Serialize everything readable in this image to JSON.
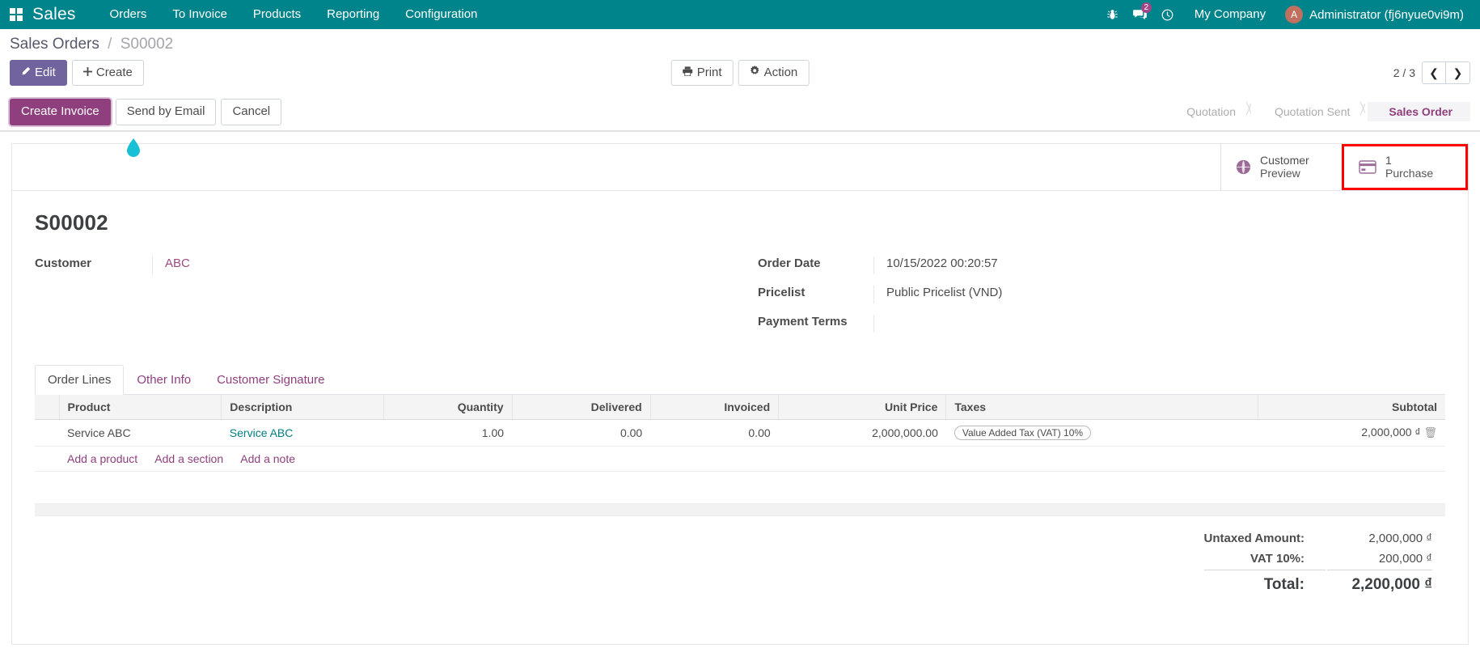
{
  "navbar": {
    "apps_icon": "apps-grid-icon",
    "brand": "Sales",
    "menu": [
      {
        "label": "Orders"
      },
      {
        "label": "To Invoice"
      },
      {
        "label": "Products"
      },
      {
        "label": "Reporting"
      },
      {
        "label": "Configuration"
      }
    ],
    "icons": [
      {
        "name": "bug-icon",
        "glyph": "☣"
      },
      {
        "name": "messages-icon",
        "glyph": "✉",
        "badge": "2"
      },
      {
        "name": "activities-clock-icon",
        "glyph": "⏱"
      }
    ],
    "company": "My Company",
    "user": {
      "initial": "A",
      "name": "Administrator (fj6nyue0vi9m)"
    }
  },
  "breadcrumb": {
    "root": "Sales Orders",
    "separator": "/",
    "current": "S00002"
  },
  "toolbar": {
    "edit_label": "Edit",
    "edit_icon": "pencil-icon",
    "create_label": "Create",
    "create_icon": "plus-icon",
    "print_label": "Print",
    "print_icon": "printer-icon",
    "action_label": "Action",
    "action_icon": "gear-icon"
  },
  "pager": {
    "value": "2 / 3",
    "prev_icon": "chevron-left-icon",
    "next_icon": "chevron-right-icon"
  },
  "statusbar_actions": [
    {
      "label": "Create Invoice",
      "style": "primary",
      "focused": true
    },
    {
      "label": "Send by Email",
      "style": "default",
      "focused": false
    },
    {
      "label": "Cancel",
      "style": "default",
      "focused": false
    }
  ],
  "statusbar_stages": [
    {
      "label": "Quotation",
      "active": false
    },
    {
      "label": "Quotation Sent",
      "active": false
    },
    {
      "label": "Sales Order",
      "active": true
    }
  ],
  "smart_buttons": [
    {
      "name": "customer-preview",
      "icon": "globe-icon",
      "line1": "Customer",
      "line2": "Preview",
      "highlighted": false
    },
    {
      "name": "purchase",
      "icon": "credit-card-icon",
      "line1": "1",
      "line2": "Purchase",
      "highlighted": true
    }
  ],
  "record": {
    "title": "S00002",
    "left_fields": [
      {
        "label": "Customer",
        "value": "ABC",
        "is_link": true
      }
    ],
    "right_fields": [
      {
        "label": "Order Date",
        "value": "10/15/2022 00:20:57",
        "is_link": false
      },
      {
        "label": "Pricelist",
        "value": "Public Pricelist (VND)",
        "is_link": false
      },
      {
        "label": "Payment Terms",
        "value": "",
        "is_link": false
      }
    ]
  },
  "tabs": [
    {
      "label": "Order Lines",
      "active": true
    },
    {
      "label": "Other Info",
      "active": false
    },
    {
      "label": "Customer Signature",
      "active": false
    }
  ],
  "order_lines": {
    "columns": [
      {
        "label": "Product",
        "align": "left"
      },
      {
        "label": "Description",
        "align": "left"
      },
      {
        "label": "Quantity",
        "align": "right"
      },
      {
        "label": "Delivered",
        "align": "right"
      },
      {
        "label": "Invoiced",
        "align": "right"
      },
      {
        "label": "Unit Price",
        "align": "right"
      },
      {
        "label": "Taxes",
        "align": "left"
      },
      {
        "label": "Subtotal",
        "align": "right"
      }
    ],
    "rows": [
      {
        "product": "Service ABC",
        "description": "Service ABC",
        "quantity": "1.00",
        "delivered": "0.00",
        "invoiced": "0.00",
        "unit_price": "2,000,000.00",
        "taxes": "Value Added Tax (VAT) 10%",
        "subtotal": "2,000,000 ₫",
        "delete_icon": "trash-icon"
      }
    ],
    "add_links": [
      {
        "label": "Add a product"
      },
      {
        "label": "Add a section"
      },
      {
        "label": "Add a note"
      }
    ]
  },
  "totals": {
    "untaxed_label": "Untaxed Amount:",
    "untaxed_value": "2,000,000 ₫",
    "tax_label": "VAT 10%:",
    "tax_value": "200,000 ₫",
    "total_label": "Total:",
    "total_value": "2,200,000 ₫"
  },
  "colors": {
    "navbar": "#00848c",
    "primary": "#71639e",
    "accent_purple": "#8f3f7e",
    "link_teal": "#017e84",
    "highlight_red": "#ff0000"
  }
}
